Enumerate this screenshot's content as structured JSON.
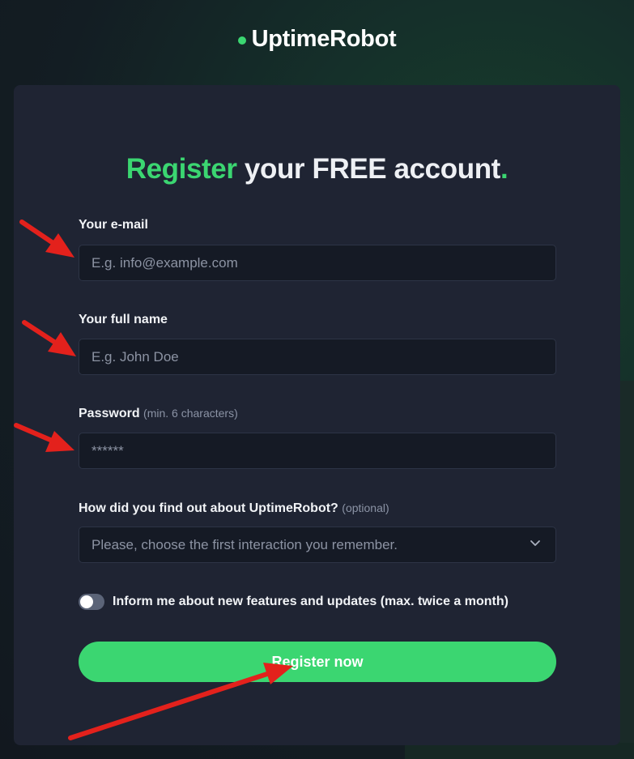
{
  "logo": {
    "text": "UptimeRobot"
  },
  "form": {
    "heading_green": "Register",
    "heading_rest": " your FREE account",
    "heading_dot": ".",
    "email": {
      "label": "Your e-mail",
      "placeholder": "E.g. info@example.com"
    },
    "full_name": {
      "label": "Your full name",
      "placeholder": "E.g. John Doe"
    },
    "password": {
      "label": "Password",
      "hint": "(min. 6 characters)",
      "placeholder": "******"
    },
    "source": {
      "label": "How did you find out about UptimeRobot?",
      "hint": "(optional)",
      "placeholder": "Please, choose the first interaction you remember."
    },
    "newsletter": {
      "label": "Inform me about new features and updates (max. twice a month)",
      "checked": false
    },
    "submit_label": "Register now"
  },
  "colors": {
    "accent": "#3bd671",
    "card": "#1f2433",
    "field": "#151a25",
    "annotation_arrow": "#e3211c"
  },
  "icons": {
    "select": "chevron-down-icon",
    "logo": "status-dot-icon"
  }
}
